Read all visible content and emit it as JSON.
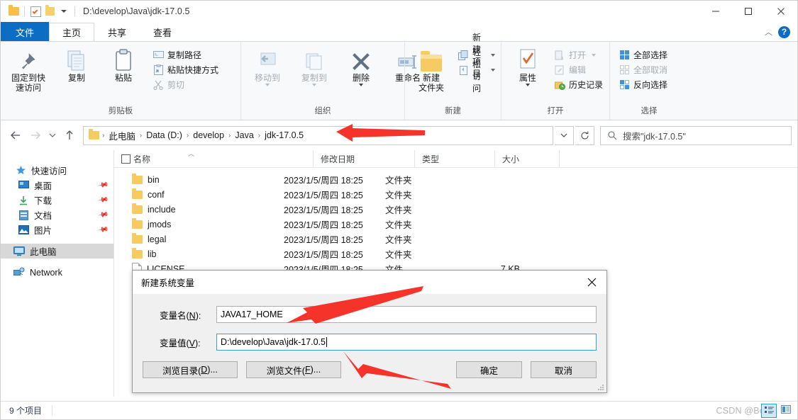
{
  "window": {
    "path_title": "D:\\develop\\Java\\jdk-17.0.5",
    "minimize": "—",
    "maximize": "▢",
    "close": "✕",
    "help": "?",
    "collapse_ribbon": "︿"
  },
  "tabs": [
    {
      "label": "文件",
      "name": "tab-file"
    },
    {
      "label": "主页",
      "name": "tab-home"
    },
    {
      "label": "共享",
      "name": "tab-share"
    },
    {
      "label": "查看",
      "name": "tab-view"
    }
  ],
  "ribbon": {
    "groups": [
      {
        "title": "剪贴板",
        "big": [
          {
            "label": "固定到快\n速访问",
            "icon": "pin-icon"
          },
          {
            "label": "复制",
            "icon": "copy-icon"
          },
          {
            "label": "粘贴",
            "icon": "paste-icon"
          }
        ],
        "small": [
          {
            "label": "复制路径",
            "icon": "copy-path-icon",
            "dim": false
          },
          {
            "label": "粘贴快捷方式",
            "icon": "paste-shortcut-icon",
            "dim": false
          },
          {
            "label": "剪切",
            "icon": "cut-icon",
            "dim": true
          }
        ]
      },
      {
        "title": "组织",
        "big": [
          {
            "label": "移动到",
            "icon": "move-to-icon",
            "dim": true
          },
          {
            "label": "复制到",
            "icon": "copy-to-icon",
            "dim": true
          },
          {
            "label": "删除",
            "icon": "delete-icon"
          },
          {
            "label": "重命名",
            "icon": "rename-icon"
          }
        ]
      },
      {
        "title": "新建",
        "big": [
          {
            "label": "新建\n文件夹",
            "icon": "new-folder-icon"
          }
        ],
        "small": [
          {
            "label": "新建项目",
            "icon": "new-item-icon",
            "dropdown": true
          },
          {
            "label": "轻松访问",
            "icon": "easy-access-icon",
            "dropdown": true
          }
        ]
      },
      {
        "title": "打开",
        "big": [
          {
            "label": "属性",
            "icon": "properties-icon"
          }
        ],
        "small": [
          {
            "label": "打开",
            "icon": "open-icon",
            "dim": true,
            "dropdown": true
          },
          {
            "label": "编辑",
            "icon": "edit-icon",
            "dim": true
          },
          {
            "label": "历史记录",
            "icon": "history-icon"
          }
        ]
      },
      {
        "title": "选择",
        "small": [
          {
            "label": "全部选择",
            "icon": "select-all-icon"
          },
          {
            "label": "全部取消",
            "icon": "select-none-icon",
            "dim": true
          },
          {
            "label": "反向选择",
            "icon": "invert-selection-icon"
          }
        ]
      }
    ]
  },
  "addressbar": {
    "back": "←",
    "forward": "→",
    "recent": "⌄",
    "up": "↑",
    "crumbs": [
      "此电脑",
      "Data (D:)",
      "develop",
      "Java",
      "jdk-17.0.5"
    ],
    "dropdown": "⌄",
    "refresh": "↻",
    "search_placeholder": "搜索\"jdk-17.0.5\"",
    "search_icon": "search-icon"
  },
  "navpane": {
    "items": [
      {
        "label": "快速访问",
        "icon": "quick-access-icon",
        "pinned": false,
        "root": true
      },
      {
        "label": "桌面",
        "icon": "desktop-icon",
        "pinned": true
      },
      {
        "label": "下载",
        "icon": "downloads-icon",
        "pinned": true
      },
      {
        "label": "文档",
        "icon": "documents-icon",
        "pinned": true
      },
      {
        "label": "图片",
        "icon": "pictures-icon",
        "pinned": true
      },
      {
        "label": "此电脑",
        "icon": "this-pc-icon",
        "pinned": false,
        "root": true,
        "selected": true
      },
      {
        "label": "Network",
        "icon": "network-icon",
        "pinned": false,
        "root": true
      }
    ]
  },
  "filelist": {
    "columns": [
      {
        "label": "名称",
        "name": "column-name"
      },
      {
        "label": "修改日期",
        "name": "column-date"
      },
      {
        "label": "类型",
        "name": "column-type"
      },
      {
        "label": "大小",
        "name": "column-size"
      }
    ],
    "rows": [
      {
        "name": "bin",
        "date": "2023/1/5/周四 18:25",
        "type": "文件夹",
        "size": "",
        "kind": "folder"
      },
      {
        "name": "conf",
        "date": "2023/1/5/周四 18:25",
        "type": "文件夹",
        "size": "",
        "kind": "folder"
      },
      {
        "name": "include",
        "date": "2023/1/5/周四 18:25",
        "type": "文件夹",
        "size": "",
        "kind": "folder"
      },
      {
        "name": "jmods",
        "date": "2023/1/5/周四 18:25",
        "type": "文件夹",
        "size": "",
        "kind": "folder"
      },
      {
        "name": "legal",
        "date": "2023/1/5/周四 18:25",
        "type": "文件夹",
        "size": "",
        "kind": "folder"
      },
      {
        "name": "lib",
        "date": "2023/1/5/周四 18:25",
        "type": "文件夹",
        "size": "",
        "kind": "folder"
      },
      {
        "name": "LICENSE",
        "date": "2023/1/5/周四 18:25",
        "type": "文件",
        "size": "7 KB",
        "kind": "file"
      }
    ]
  },
  "statusbar": {
    "count": "9 个项目",
    "watermark": "CSDN @Bo",
    "view_details_icon": "details-view-icon",
    "view_large_icon": "large-icons-view-icon"
  },
  "dialog": {
    "title": "新建系统变量",
    "close": "✕",
    "fields": [
      {
        "label_pre": "变量名(",
        "label_key": "N",
        "label_post": "):",
        "value": "JAVA17_HOME",
        "focused": false,
        "name": "variable-name"
      },
      {
        "label_pre": "变量值(",
        "label_key": "V",
        "label_post": "):",
        "value": "D:\\develop\\Java\\jdk-17.0.5",
        "focused": true,
        "name": "variable-value"
      }
    ],
    "buttons": [
      {
        "pre": "浏览目录(",
        "key": "D",
        "post": ")...",
        "name": "browse-directory-button",
        "wide": true
      },
      {
        "pre": "浏览文件(",
        "key": "F",
        "post": ")...",
        "name": "browse-file-button",
        "wide": true
      },
      {
        "pre": "确定",
        "key": "",
        "post": "",
        "name": "ok-button",
        "wide": false
      },
      {
        "pre": "取消",
        "key": "",
        "post": "",
        "name": "cancel-button",
        "wide": false
      }
    ]
  },
  "annotations": {
    "arrow_color": "#f5332b",
    "arrows": [
      {
        "name": "arrow-to-path",
        "target": "address-bar-path"
      },
      {
        "name": "arrow-to-variable-name",
        "target": "variable-name-input"
      },
      {
        "name": "arrow-to-variable-value",
        "target": "variable-value-input"
      }
    ]
  }
}
